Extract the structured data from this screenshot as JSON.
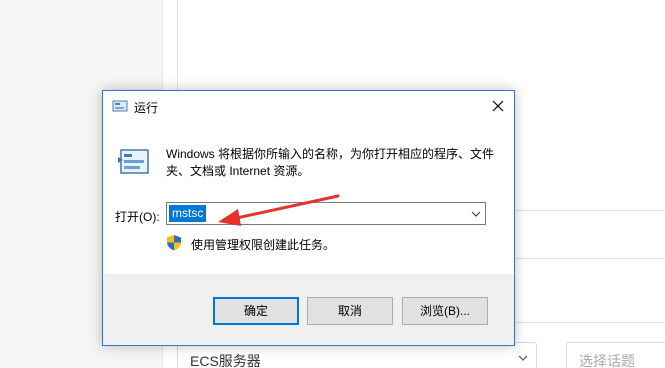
{
  "background": {
    "ecs_select": {
      "value": "ECS服务器"
    },
    "topic_select": {
      "placeholder": "选择话题"
    }
  },
  "dialog": {
    "title": "运行",
    "description": "Windows 将根据你所输入的名称，为你打开相应的程序、文件夹、文档或 Internet 资源。",
    "open_label": "打开(O):",
    "input_value": "mstsc",
    "admin_note": "使用管理权限创建此任务。",
    "buttons": {
      "ok": "确定",
      "cancel": "取消",
      "browse": "浏览(B)..."
    }
  },
  "colors": {
    "accent": "#0078d7",
    "annotation_arrow": "#e5322d"
  }
}
